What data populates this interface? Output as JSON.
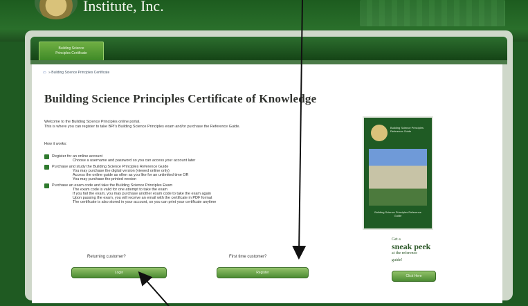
{
  "header": {
    "org_name": "Institute, Inc."
  },
  "nav": {
    "tab_line1": "Building Science",
    "tab_line2": "Principles Certificate"
  },
  "breadcrumb": {
    "current": "» Building Science Principles Certificate"
  },
  "main": {
    "title": "Building Science Principles Certificate of Knowledge",
    "intro_1": "Welcome to the Building Science Principles online portal.",
    "intro_2": "This is where you can register to take BPI's Building Science Principles exam and/or purchase the Reference Guide.",
    "how_it_works": "How it works:",
    "steps": [
      {
        "heading": "Register for an online account",
        "subs": [
          "Choose a username and password so you can access your account later"
        ]
      },
      {
        "heading": "Purchase and study the Building Science Principles Reference Guide",
        "subs": [
          "You may purchase the digital version (viewed online only)",
          "Access the online guide as often as you like for an unlimited time OR",
          "You may purchase the printed version"
        ]
      },
      {
        "heading": "Purchase an exam code and take the Building Science Principles Exam",
        "subs": [
          "The exam code is valid for one attempt to take the exam",
          "If you fail the exam, you may purchase another exam code to take the exam again",
          "Upon passing the exam, you will receive an email with the certificate in PDF format",
          "The certificate is also stored in your account, so you can print your certificate anytime"
        ]
      }
    ],
    "returning": {
      "question": "Returning customer?",
      "button": "Login"
    },
    "first_time": {
      "question": "First time customer?",
      "button": "Register"
    }
  },
  "sidebar": {
    "ref_title": "Building Science Principles Reference Guide",
    "bottom_text": "Building Science Principles Reference Guide",
    "sneak_line1": "Get a",
    "sneak_line2": "sneak peek",
    "sneak_line3": "at the reference",
    "sneak_line4": "guide!",
    "sneak_button": "Click Here"
  },
  "colors": {
    "brand_green": "#1f5a22",
    "button_green": "#4c8c33"
  }
}
